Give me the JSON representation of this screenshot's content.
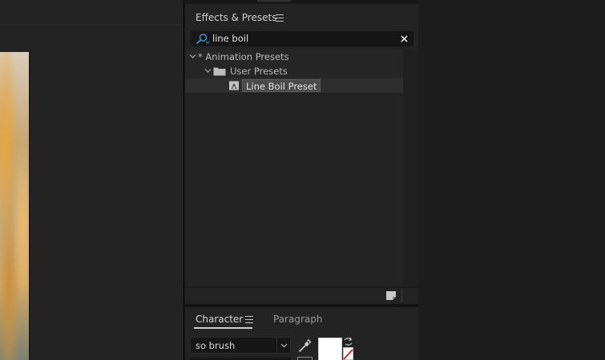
{
  "effects_presets": {
    "title": "Effects & Presets",
    "search_value": "line boil",
    "tree": [
      {
        "label": "* Animation Presets",
        "level": 0,
        "expanded": true
      },
      {
        "label": "User Presets",
        "level": 1,
        "expanded": true
      },
      {
        "label": "Line Boil Preset",
        "level": 2,
        "selected": true
      }
    ]
  },
  "character": {
    "tabs": [
      {
        "label": "Character",
        "active": true
      },
      {
        "label": "Paragraph",
        "active": false
      }
    ],
    "font_family": "so brush",
    "fill_color": "#ffffff"
  },
  "colors": {
    "panel_bg": "#232323",
    "divider": "#121212",
    "search_bg": "#161616",
    "accent_blue": "#3e8fd8",
    "text": "#b8b8b8",
    "stroke_red": "#d0281e"
  },
  "icons": [
    "search-icon",
    "clear-search-icon",
    "chevron-down-icon",
    "folder-icon",
    "animation-preset-icon",
    "new-bin-icon",
    "panel-menu-icon",
    "eyedropper-icon",
    "swap-colors-icon"
  ]
}
